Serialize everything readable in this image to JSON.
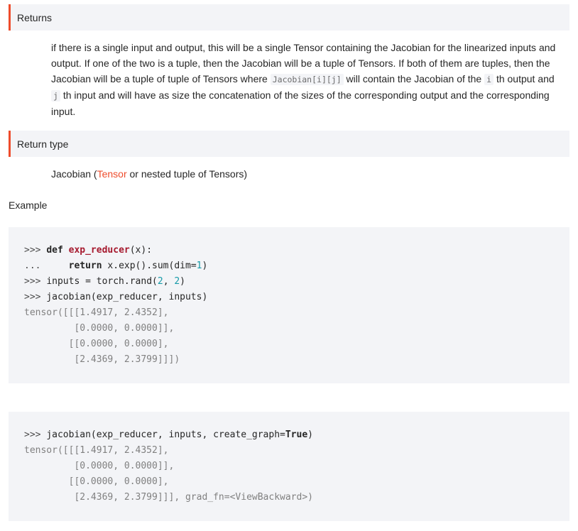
{
  "returns": {
    "heading": "Returns",
    "text_1": "if there is a single input and output, this will be a single Tensor containing the Jacobian for the linearized inputs and output. If one of the two is a tuple, then the Jacobian will be a tuple of Tensors. If both of them are tuples, then the Jacobian will be a tuple of tuple of Tensors where ",
    "code_1": "Jacobian[i][j]",
    "text_2": " will contain the Jacobian of the ",
    "code_2": "i",
    "text_3": " th output and ",
    "code_3": "j",
    "text_4": " th input and will have as size the concatenation of the sizes of the corresponding output and the corresponding input."
  },
  "return_type": {
    "heading": "Return type",
    "prefix": "Jacobian (",
    "link": "Tensor",
    "suffix": " or nested tuple of Tensors)"
  },
  "example_label": "Example",
  "code_block_1": {
    "lines": [
      {
        "prompt": ">>> ",
        "kw": "def",
        "sp": " ",
        "fn": "exp_reducer",
        "rest": "(x):"
      },
      {
        "prompt": "...     ",
        "kw": "return",
        "rest_a": " x.exp().sum(dim=",
        "num": "1",
        "rest_b": ")"
      },
      {
        "prompt": ">>> ",
        "rest_a": "inputs = torch.rand(",
        "num1": "2",
        "mid": ", ",
        "num2": "2",
        "rest_b": ")"
      },
      {
        "prompt": ">>> ",
        "rest": "jacobian(exp_reducer, inputs)"
      }
    ],
    "output": [
      "tensor([[[1.4917, 2.4352],",
      "         [0.0000, 0.0000]],",
      "        [[0.0000, 0.0000],",
      "         [2.4369, 2.3799]]])"
    ]
  },
  "code_block_2": {
    "prompt": ">>> ",
    "rest_a": "jacobian(exp_reducer, inputs, create_graph=",
    "kw": "True",
    "rest_b": ")",
    "output": [
      "tensor([[[1.4917, 2.4352],",
      "         [0.0000, 0.0000]],",
      "        [[0.0000, 0.0000],",
      "         [2.4369, 2.3799]]], grad_fn=<ViewBackward>)"
    ]
  }
}
